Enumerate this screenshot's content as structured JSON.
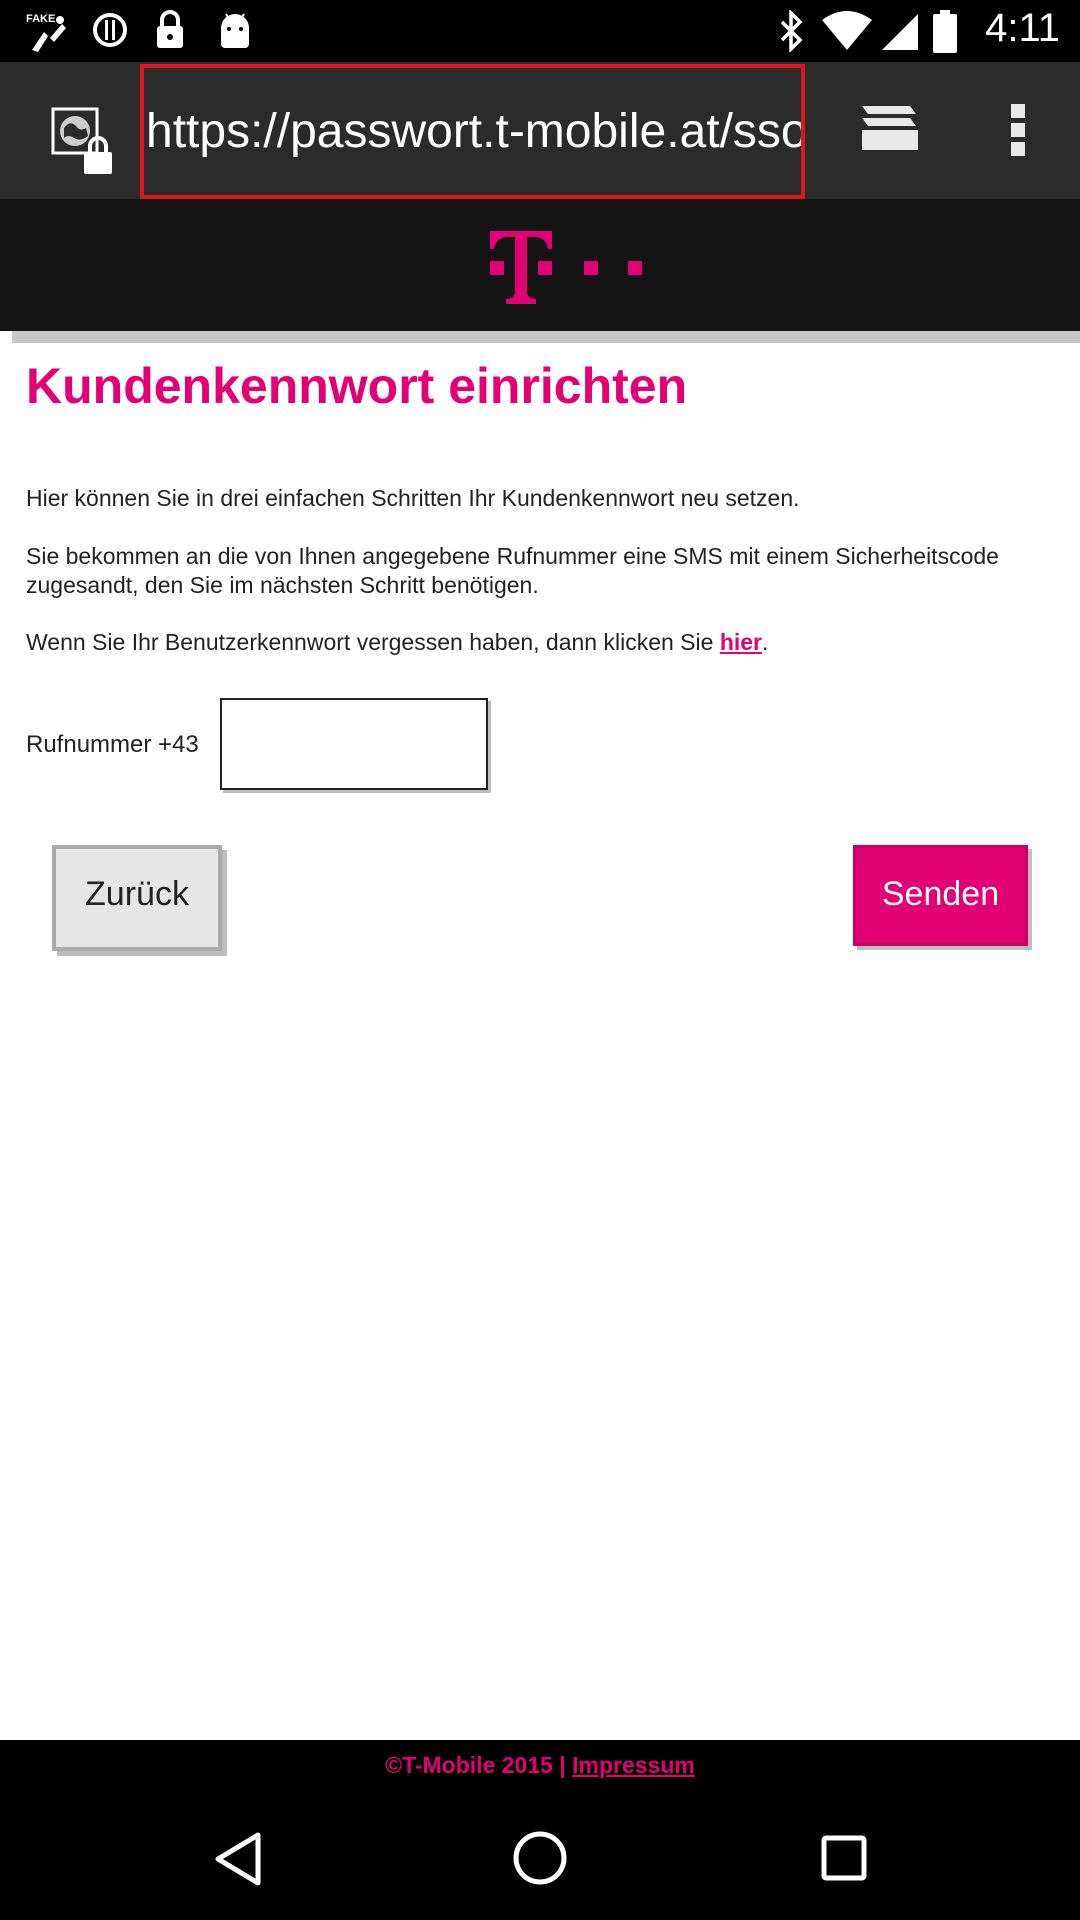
{
  "status_bar": {
    "time": "4:11",
    "icons": [
      "fake-gps-icon",
      "sync-icon",
      "lock-icon",
      "android-icon",
      "bluetooth-icon",
      "wifi-icon",
      "cell-signal-icon",
      "battery-icon"
    ]
  },
  "browser": {
    "url": "https://passwort.t-mobile.at/sso",
    "site_icon": "secure-site-icon",
    "tabs_icon": "tabs-icon",
    "menu_icon": "overflow-menu-icon"
  },
  "brand": {
    "logo": "t-mobile-logo",
    "color": "#e20074"
  },
  "page": {
    "title": "Kundenkennwort einrichten",
    "paragraph1": "Hier können Sie in drei einfachen Schritten Ihr Kundenkennwort neu setzen.",
    "paragraph2": "Sie bekommen an die von Ihnen angegebene Rufnummer eine SMS mit einem Sicherheitscode zugesandt, den Sie im nächsten Schritt benötigen.",
    "paragraph3_prefix": "Wenn Sie Ihr Benutzerkennwort vergessen haben, dann klicken Sie ",
    "paragraph3_link": "hier",
    "paragraph3_suffix": ".",
    "phone_label": "Rufnummer +43",
    "phone_value": "",
    "back_button": "Zurück",
    "send_button": "Senden"
  },
  "footer": {
    "copyright": "©T-Mobile 2015 | ",
    "link": "Impressum"
  },
  "nav_bar": {
    "back": "back-icon",
    "home": "home-icon",
    "recent": "recent-apps-icon"
  }
}
